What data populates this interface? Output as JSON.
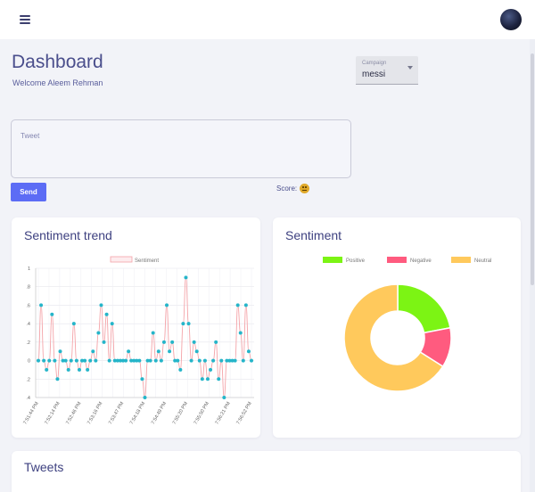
{
  "header": {
    "menu_icon": "hamburger-icon",
    "avatar": "user-avatar"
  },
  "page": {
    "title": "Dashboard",
    "welcome": "Welcome Aleem Rehman"
  },
  "campaign": {
    "label": "Campaign",
    "value": "messi"
  },
  "tweet_input": {
    "placeholder": "Tweet",
    "value": ""
  },
  "send_label": "Send",
  "score": {
    "label": "Score:",
    "icon": "neutral-face-icon"
  },
  "trend_card": {
    "title": "Sentiment trend"
  },
  "sentiment_card": {
    "title": "Sentiment"
  },
  "tweets_card": {
    "title": "Tweets"
  },
  "colors": {
    "accent": "#5c6cf5",
    "trend_point": "#25b5c9",
    "trend_line": "#f4a3a8",
    "positive": "#7cf414",
    "negative": "#ff5b7f",
    "neutral": "#ffc95c"
  },
  "chart_data": [
    {
      "type": "line",
      "title": "",
      "legend": [
        "Sentiment"
      ],
      "legend_placement": "top",
      "grid": true,
      "ylim": [
        -0.4,
        1
      ],
      "yticks": [
        "1",
        ".8",
        ".6",
        ".4",
        ".2",
        "0",
        ".2",
        ".4"
      ],
      "xticks": [
        "7:51:44 PM",
        "7:51:59 PM",
        "7:52:14 PM",
        "7:52:30 PM",
        "7:52:46 PM",
        "7:53:01 PM",
        "7:53:16 PM",
        "7:53:32 PM",
        "7:53:47 PM",
        "7:54:02 PM",
        "7:54:18 PM",
        "7:54:33 PM",
        "7:54:49 PM",
        "7:55:04 PM",
        "7:55:20 PM",
        "7:55:35 PM",
        "7:55:50 PM",
        "7:56:06 PM",
        "7:56:21 PM",
        "7:56:37 PM",
        "7:56:52 PM"
      ],
      "series": [
        {
          "name": "Sentiment",
          "values": [
            0,
            0.6,
            0,
            -0.1,
            0,
            0.5,
            0,
            -0.2,
            0.1,
            0,
            0,
            -0.1,
            0,
            0.4,
            0,
            -0.1,
            0,
            0,
            -0.1,
            0,
            0.1,
            0,
            0.3,
            0.6,
            0.2,
            0.5,
            0,
            0.4,
            0,
            0,
            0,
            0,
            0,
            0.1,
            0,
            0,
            0,
            0,
            -0.2,
            -0.4,
            0,
            0,
            0.3,
            0,
            0.1,
            0,
            0.2,
            0.6,
            0.1,
            0.2,
            0,
            0,
            -0.1,
            0.4,
            0.9,
            0.4,
            0,
            0.2,
            0.1,
            0,
            -0.2,
            0,
            -0.2,
            -0.1,
            0,
            0.2,
            -0.2,
            0,
            -0.4,
            0,
            0,
            0,
            0,
            0.6,
            0.3,
            0,
            0.6,
            0.1,
            0
          ]
        }
      ]
    },
    {
      "type": "pie",
      "title": "",
      "legend": [
        "Positive",
        "Negative",
        "Neutral"
      ],
      "legend_placement": "top",
      "categories": [
        "Positive",
        "Negative",
        "Neutral"
      ],
      "values": [
        22,
        12,
        66
      ]
    }
  ]
}
